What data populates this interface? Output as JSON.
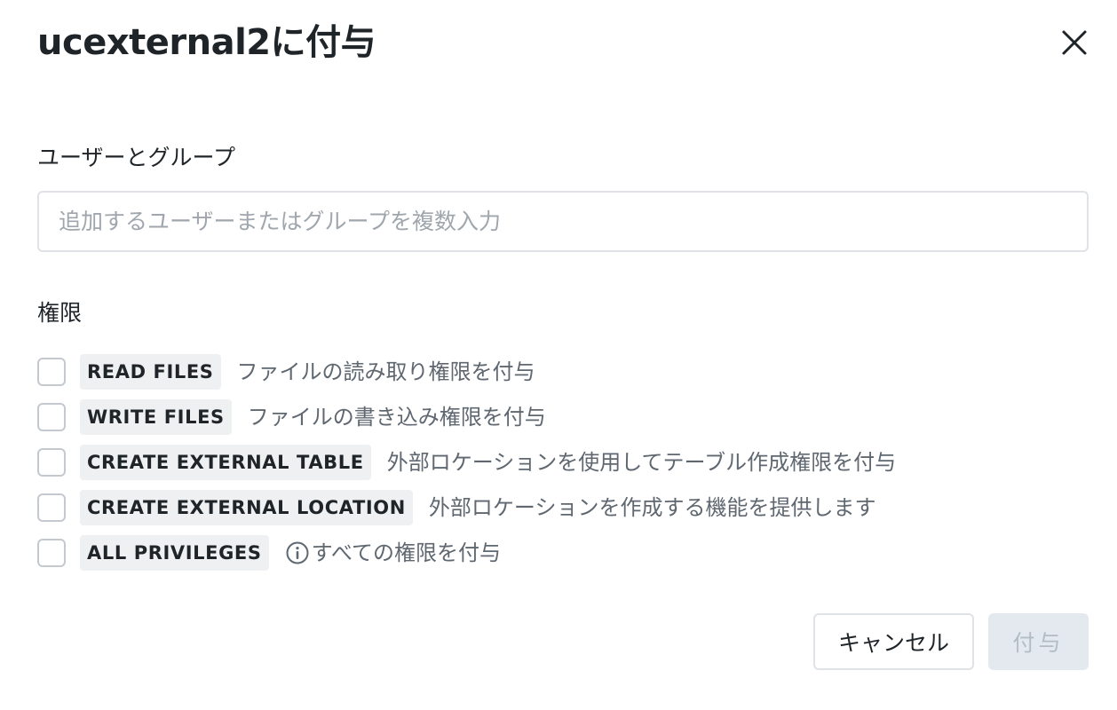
{
  "dialog": {
    "title": "ucexternal2に付与"
  },
  "principals": {
    "label": "ユーザーとグループ",
    "placeholder": "追加するユーザーまたはグループを複数入力",
    "value": ""
  },
  "privileges": {
    "label": "権限",
    "items": [
      {
        "name": "READ FILES",
        "description": "ファイルの読み取り権限を付与",
        "checked": false,
        "has_info_icon": false
      },
      {
        "name": "WRITE FILES",
        "description": "ファイルの書き込み権限を付与",
        "checked": false,
        "has_info_icon": false
      },
      {
        "name": "CREATE EXTERNAL TABLE",
        "description": "外部ロケーションを使用してテーブル作成権限を付与",
        "checked": false,
        "has_info_icon": false
      },
      {
        "name": "CREATE EXTERNAL LOCATION",
        "description": "外部ロケーションを作成する機能を提供します",
        "checked": false,
        "has_info_icon": false
      },
      {
        "name": "ALL PRIVILEGES",
        "description": "すべての権限を付与",
        "checked": false,
        "has_info_icon": true
      }
    ]
  },
  "footer": {
    "cancel_label": "キャンセル",
    "grant_label": "付与",
    "grant_enabled": false
  },
  "icons": {
    "close": "close-icon",
    "info": "info-icon"
  },
  "colors": {
    "text_primary": "#1f2428",
    "text_secondary": "#5f6770",
    "tag_background": "#eef0f2",
    "border": "#dfe2e6",
    "disabled_button_bg": "#e3e9ef",
    "disabled_button_text": "#b3bcc5"
  }
}
